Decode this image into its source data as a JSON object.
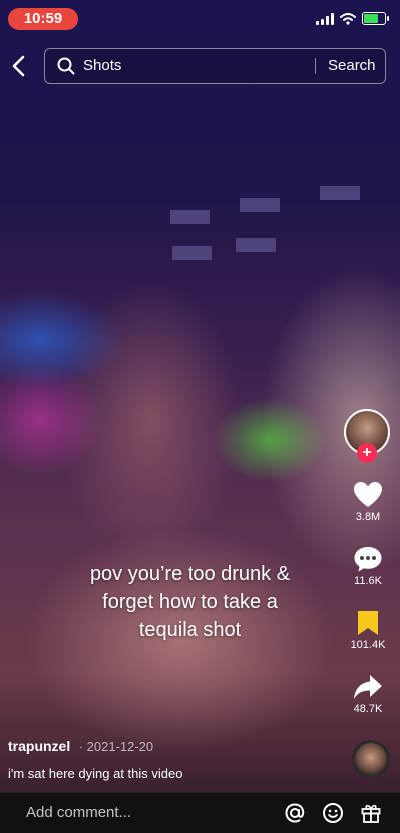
{
  "status_bar": {
    "time": "10:59",
    "battery_level": 0.75
  },
  "search": {
    "query": "Shots",
    "button_label": "Search"
  },
  "video": {
    "caption_lines": [
      "pov you’re too drunk &",
      "forget how to take a",
      "tequila shot"
    ],
    "username": "trapunzel",
    "date": "· 2021-12-20",
    "description": "i'm sat here dying at this video"
  },
  "actions": {
    "likes": "3.8M",
    "comments": "11.6K",
    "saves": "101.4K",
    "shares": "48.7K",
    "follow_symbol": "+"
  },
  "comment_bar": {
    "placeholder": "Add comment..."
  },
  "colors": {
    "accent": "#fe2c55",
    "time_pill": "#e8453c",
    "bookmark": "#f7c71c"
  },
  "icons": [
    "back-chevron-icon",
    "search-icon",
    "heart-icon",
    "comment-icon",
    "bookmark-icon",
    "share-icon",
    "at-icon",
    "emoji-icon",
    "gift-icon"
  ]
}
